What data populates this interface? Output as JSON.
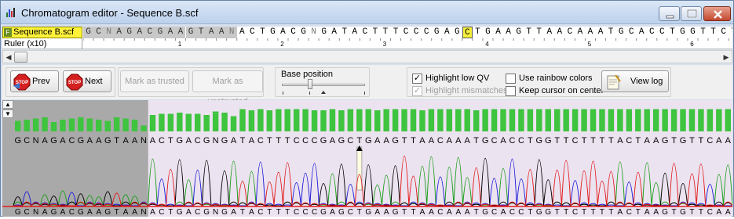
{
  "window": {
    "title": "Chromatogram editor - Sequence B.scf"
  },
  "sequence_track": {
    "label": "Sequence B.scf",
    "bases": "GCNAGACGAAGTAANACTGACGNGATACTTTCCCGAGCTGAAGTTAACAAATGCACCTGGTTCT",
    "grey_count": 15,
    "cursor_index": 37
  },
  "ruler": {
    "label": "Ruler (x10)",
    "marks": [
      "1",
      "2",
      "3",
      "4",
      "5",
      "6"
    ]
  },
  "toolbar": {
    "prev_label": "Prev",
    "next_label": "Next",
    "next_icon_text": "STOP",
    "prev_icon_text": "STOP",
    "mark_trusted_label": "Mark as trusted",
    "mark_untrusted_label": "Mark as unstrusted",
    "base_position_label": "Base position",
    "highlight_low_qv_label": "Highlight low QV",
    "highlight_low_qv_checked": true,
    "highlight_mismatches_label": "Highlight mismatches",
    "highlight_mismatches_checked": true,
    "use_rainbow_label": "Use rainbow colors",
    "use_rainbow_checked": false,
    "keep_cursor_label": "Keep cursor on center",
    "keep_cursor_checked": false,
    "view_log_label": "View log"
  },
  "chromatogram": {
    "called_bases": "GCNAGACGAAGTAANACTGACGNGATACTTTCCCGAGCTGAAGTTAACAAATGCACCTGGTTCTTTTACTAAGTGTTCAA",
    "grey_count": 15,
    "cursor_index": 38,
    "quality": [
      18,
      20,
      22,
      24,
      16,
      20,
      22,
      24,
      22,
      20,
      18,
      24,
      22,
      20,
      10,
      28,
      30,
      30,
      32,
      30,
      30,
      28,
      34,
      32,
      26,
      38,
      36,
      38,
      36,
      38,
      38,
      38,
      38,
      36,
      36,
      38,
      36,
      38,
      38,
      38,
      36,
      38,
      38,
      38,
      38,
      36,
      38,
      38,
      38,
      38,
      38,
      36,
      38,
      38,
      38,
      38,
      38,
      38,
      38,
      38,
      38,
      38,
      38,
      38,
      38,
      38,
      38,
      38,
      38,
      38,
      38,
      38,
      38,
      38,
      38,
      38,
      38,
      38,
      38,
      38,
      38
    ],
    "colors": {
      "A": "#1a9e1a",
      "C": "#1c1cd8",
      "G": "#000000",
      "T": "#e01c1c",
      "N": "#555555",
      "grey_bg": "#a9a9a9",
      "main_bg": "#ece3f0",
      "qv_bar": "#3fc43f"
    }
  }
}
